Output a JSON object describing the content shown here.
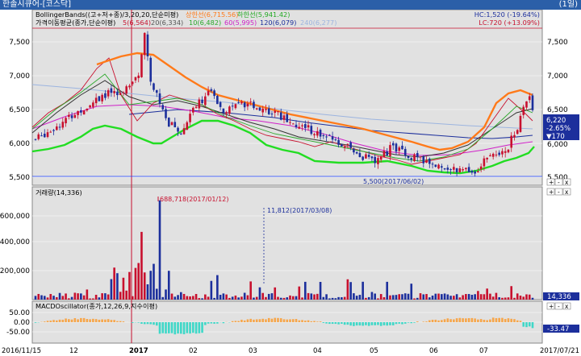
{
  "window": {
    "title": "한솔시큐어-[코스닥]",
    "period": "(1일)"
  },
  "panels": {
    "price": {
      "bb_label": "BollingerBands((고+저+종)/3,20,20,단순미평)",
      "bb_upper": "상한선(6,715.56)",
      "bb_lower": "하한선(5,941.42)",
      "ma_label": "가격이동평균(종가,단순이평)",
      "ma_items": [
        "5(6,564)",
        "20(6,334)",
        "10(6,482)",
        "60(5,995)",
        "120(6,079)",
        "240(6,277)"
      ],
      "hc": "HC:1,520 (-19.64%)",
      "lc": "LC:720 (+13.09%)",
      "low_annotation": "5,500(2017/06/02)",
      "current_price": "6,220",
      "change_pct": "-2.65%",
      "change_abs": "▼170",
      "yaxis": [
        "7,500",
        "7,000",
        "6,500",
        "6,000",
        "5,500"
      ]
    },
    "volume": {
      "label": "거래량(14,336)",
      "ann_peak": "688,718(2017/01/12)",
      "ann_second": "11,812(2017/03/08)",
      "current": "14,336",
      "yaxis": [
        "600,000",
        "400,000",
        "200,000"
      ]
    },
    "macd": {
      "label": "MACDOscillator(종가,12,26,9,지수이평)",
      "value": "-33.47",
      "yaxis": [
        "50.00",
        "0.00",
        "-50.00"
      ]
    }
  },
  "xaxis": [
    "2016/11/15",
    "12",
    "2017",
    "02",
    "03",
    "04",
    "05",
    "06",
    "07",
    "2017/07/21"
  ],
  "panel_buttons": [
    "+",
    "-",
    "x"
  ],
  "colors": {
    "up": "#c8102e",
    "down": "#1c2f9c",
    "upper_band": "#ff7a1a",
    "lower_band": "#22dd22",
    "bg": "#e1e1e1"
  },
  "chart_data": {
    "type": "candlestick",
    "x": [
      "2016/11/15",
      "2017/07/21"
    ],
    "ohlc_approx": [
      {
        "date": "2016/11/15",
        "close": 6000
      },
      {
        "date": "2016/12/20",
        "high": 7650,
        "close": 7000
      },
      {
        "date": "2017/01/12",
        "close": 6250
      },
      {
        "date": "2017/02/10",
        "close": 6550
      },
      {
        "date": "2017/04/25",
        "close": 5750
      },
      {
        "date": "2017/06/02",
        "low": 5500,
        "close": 5600
      },
      {
        "date": "2017/07/10",
        "high": 6800,
        "close": 6700
      },
      {
        "date": "2017/07/21",
        "close": 6220
      }
    ],
    "ylim": [
      5400,
      7800
    ],
    "volume_ylim": [
      0,
      760000
    ],
    "volume_peaks": [
      {
        "date": "2017/01/12",
        "value": 688718
      },
      {
        "date": "2017/03/08",
        "value": 11812
      }
    ],
    "macd_ylim": [
      -70,
      70
    ]
  }
}
